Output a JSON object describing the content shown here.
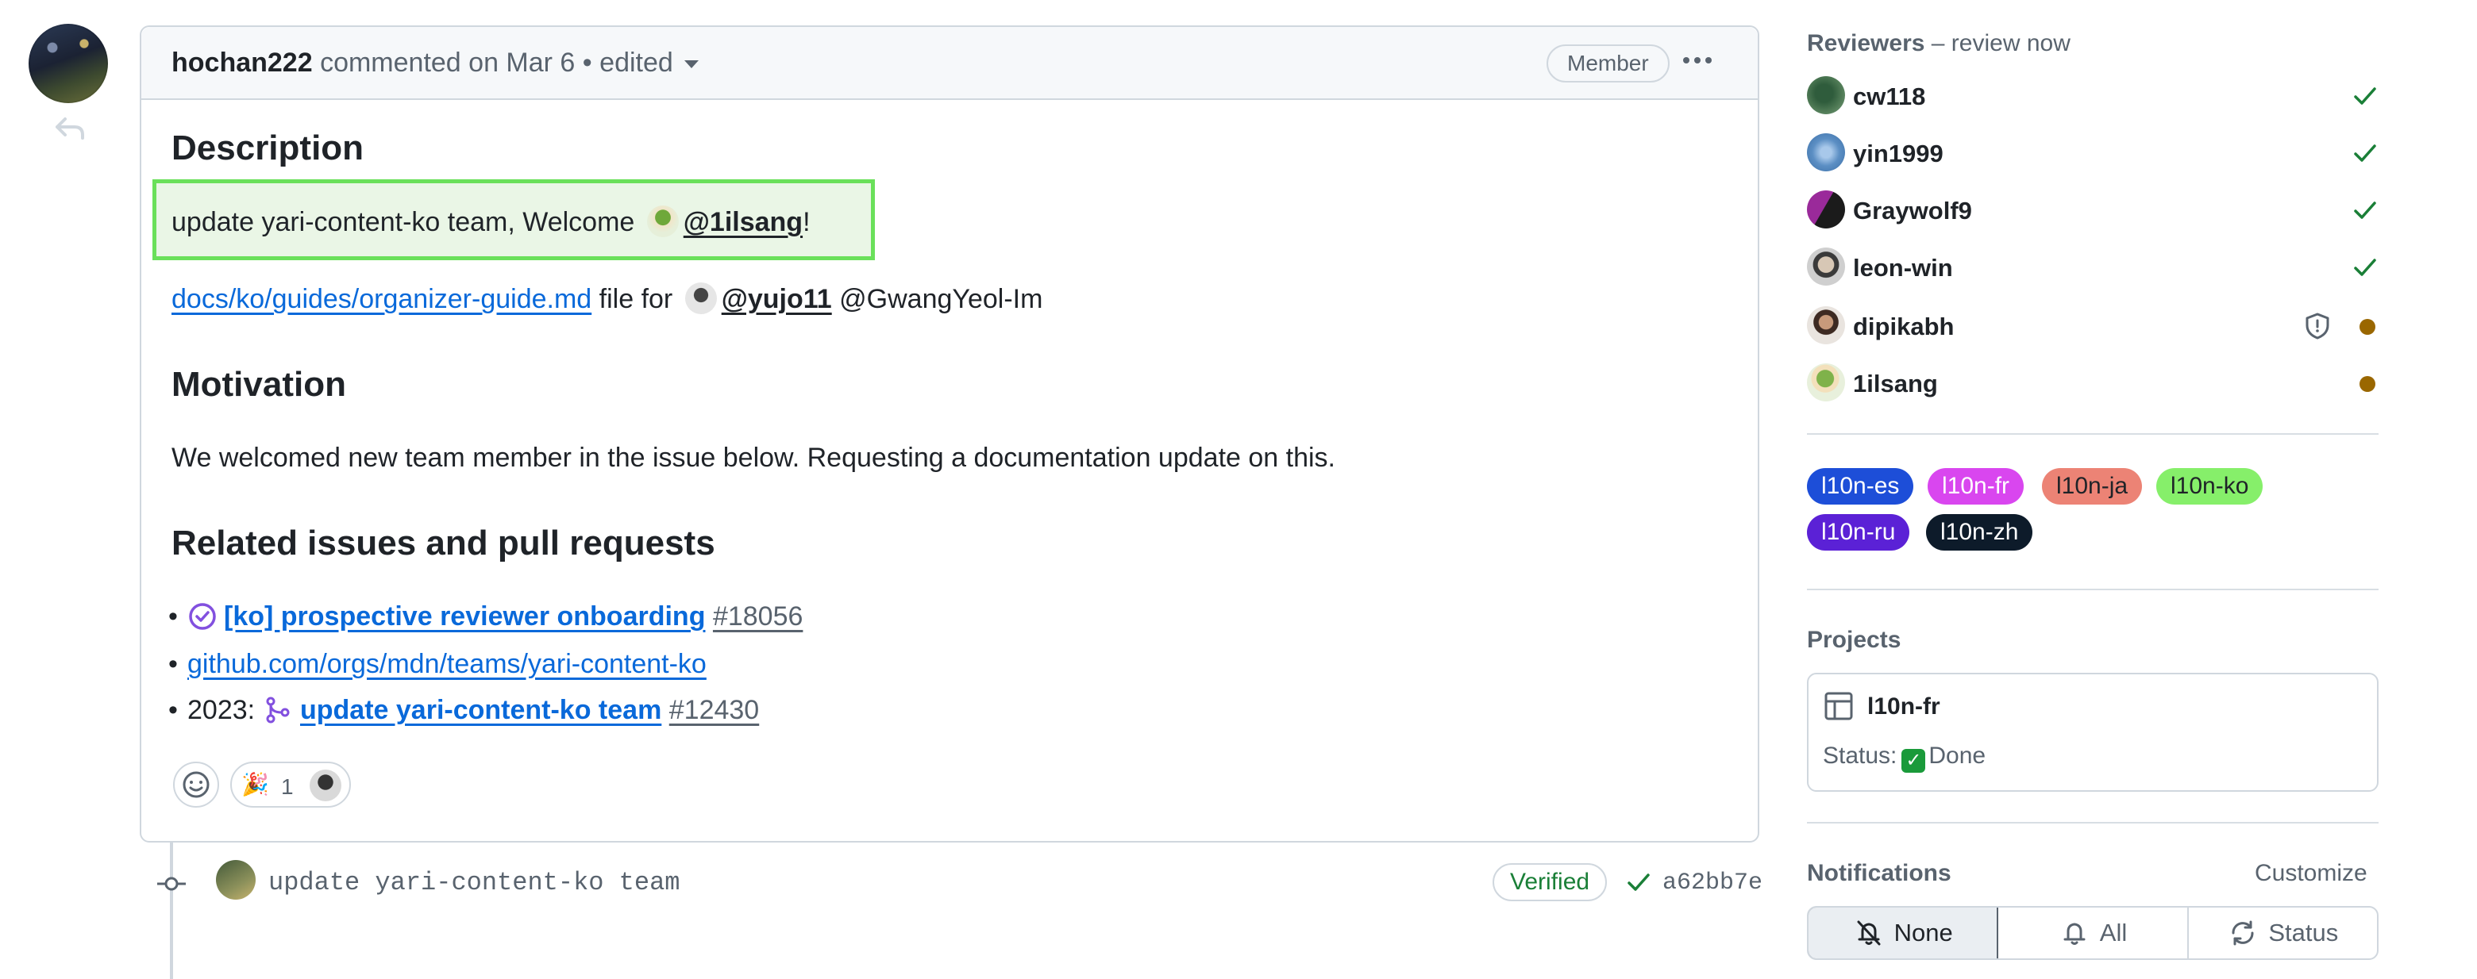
{
  "comment": {
    "author": "hochan222",
    "action": "commented on Mar 6",
    "separator": "•",
    "edited": "edited",
    "role_badge": "Member",
    "description_heading": "Description",
    "highlight_text": "update yari-content-ko team, Welcome",
    "highlight_mention": "@1ilsang",
    "highlight_end": "!",
    "file_link": "docs/ko/guides/organizer-guide.md",
    "file_for": "file for",
    "mention_yujo": "@yujo11",
    "mention_gwang": "@GwangYeol-Im",
    "motivation_heading": "Motivation",
    "motivation_text": "We welcomed new team member in the issue below. Requesting a documentation update on this.",
    "related_heading": "Related issues and pull requests",
    "related": {
      "issue_title": "[ko] prospective reviewer onboarding",
      "issue_number": "#18056",
      "team_link": "github.com/orgs/mdn/teams/yari-content-ko",
      "pr_prefix": "2023:",
      "pr_title": "update yari-content-ko team",
      "pr_number": "#12430"
    },
    "reaction": {
      "emoji": "🎉",
      "count": "1"
    }
  },
  "commit": {
    "message": "update yari-content-ko team",
    "verified": "Verified",
    "sha": "a62bb7e"
  },
  "sidebar": {
    "reviewers_title": "Reviewers",
    "reviewers_sub": "– review now",
    "reviewers": [
      {
        "name": "cw118",
        "status": "approved"
      },
      {
        "name": "yin1999",
        "status": "approved"
      },
      {
        "name": "Graywolf9",
        "status": "approved"
      },
      {
        "name": "leon-win",
        "status": "approved"
      },
      {
        "name": "dipikabh",
        "status": "pending-codeowner"
      },
      {
        "name": "1ilsang",
        "status": "pending"
      }
    ],
    "labels": [
      {
        "text": "l10n-es",
        "bg": "#1d4ed8",
        "fg": "#ffffff"
      },
      {
        "text": "l10n-fr",
        "bg": "#d946ef",
        "fg": "#ffffff"
      },
      {
        "text": "l10n-ja",
        "bg": "#ec8375",
        "fg": "#1f2328"
      },
      {
        "text": "l10n-ko",
        "bg": "#86ef6a",
        "fg": "#1f2328"
      },
      {
        "text": "l10n-ru",
        "bg": "#5b21d6",
        "fg": "#ffffff"
      },
      {
        "text": "l10n-zh",
        "bg": "#0d1b2a",
        "fg": "#ffffff"
      }
    ],
    "projects_title": "Projects",
    "project_name": "l10n-fr",
    "project_status_label": "Status:",
    "project_status_value": "Done",
    "notifications_title": "Notifications",
    "customize": "Customize",
    "notify_options": [
      "None",
      "All",
      "Status"
    ]
  },
  "colors": {
    "link": "#0969da",
    "approved": "#1a7f37",
    "pending": "#9a6700",
    "highlight_border": "#6ae05a"
  }
}
